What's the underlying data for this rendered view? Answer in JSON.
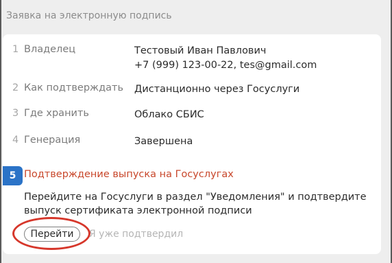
{
  "page": {
    "title": "Заявка на электронную подпись"
  },
  "steps": [
    {
      "number": "1",
      "label": "Владелец",
      "value_line1": "Тестовый Иван Павлович",
      "value_line2": "+7 (999) 123-00-22, tes@gmail.com"
    },
    {
      "number": "2",
      "label": "Как подтверждать",
      "value_line1": "Дистанционно через Госуслуги"
    },
    {
      "number": "3",
      "label": "Где хранить",
      "value_line1": "Облако СБИС"
    },
    {
      "number": "4",
      "label": "Генерация",
      "value_line1": "Завершена"
    }
  ],
  "active_step": {
    "number": "5",
    "title": "Подтверждение выпуска на Госуслугах",
    "description": "Перейдите на Госуслуги в раздел \"Уведомления\" и подтвердите выпуск сертификата электронной подписи",
    "go_button": "Перейти",
    "confirmed_link": "Я уже подтвердил"
  },
  "colors": {
    "accent": "#2b73c7",
    "active_title": "#c8472b",
    "annotation": "#d6372b"
  }
}
